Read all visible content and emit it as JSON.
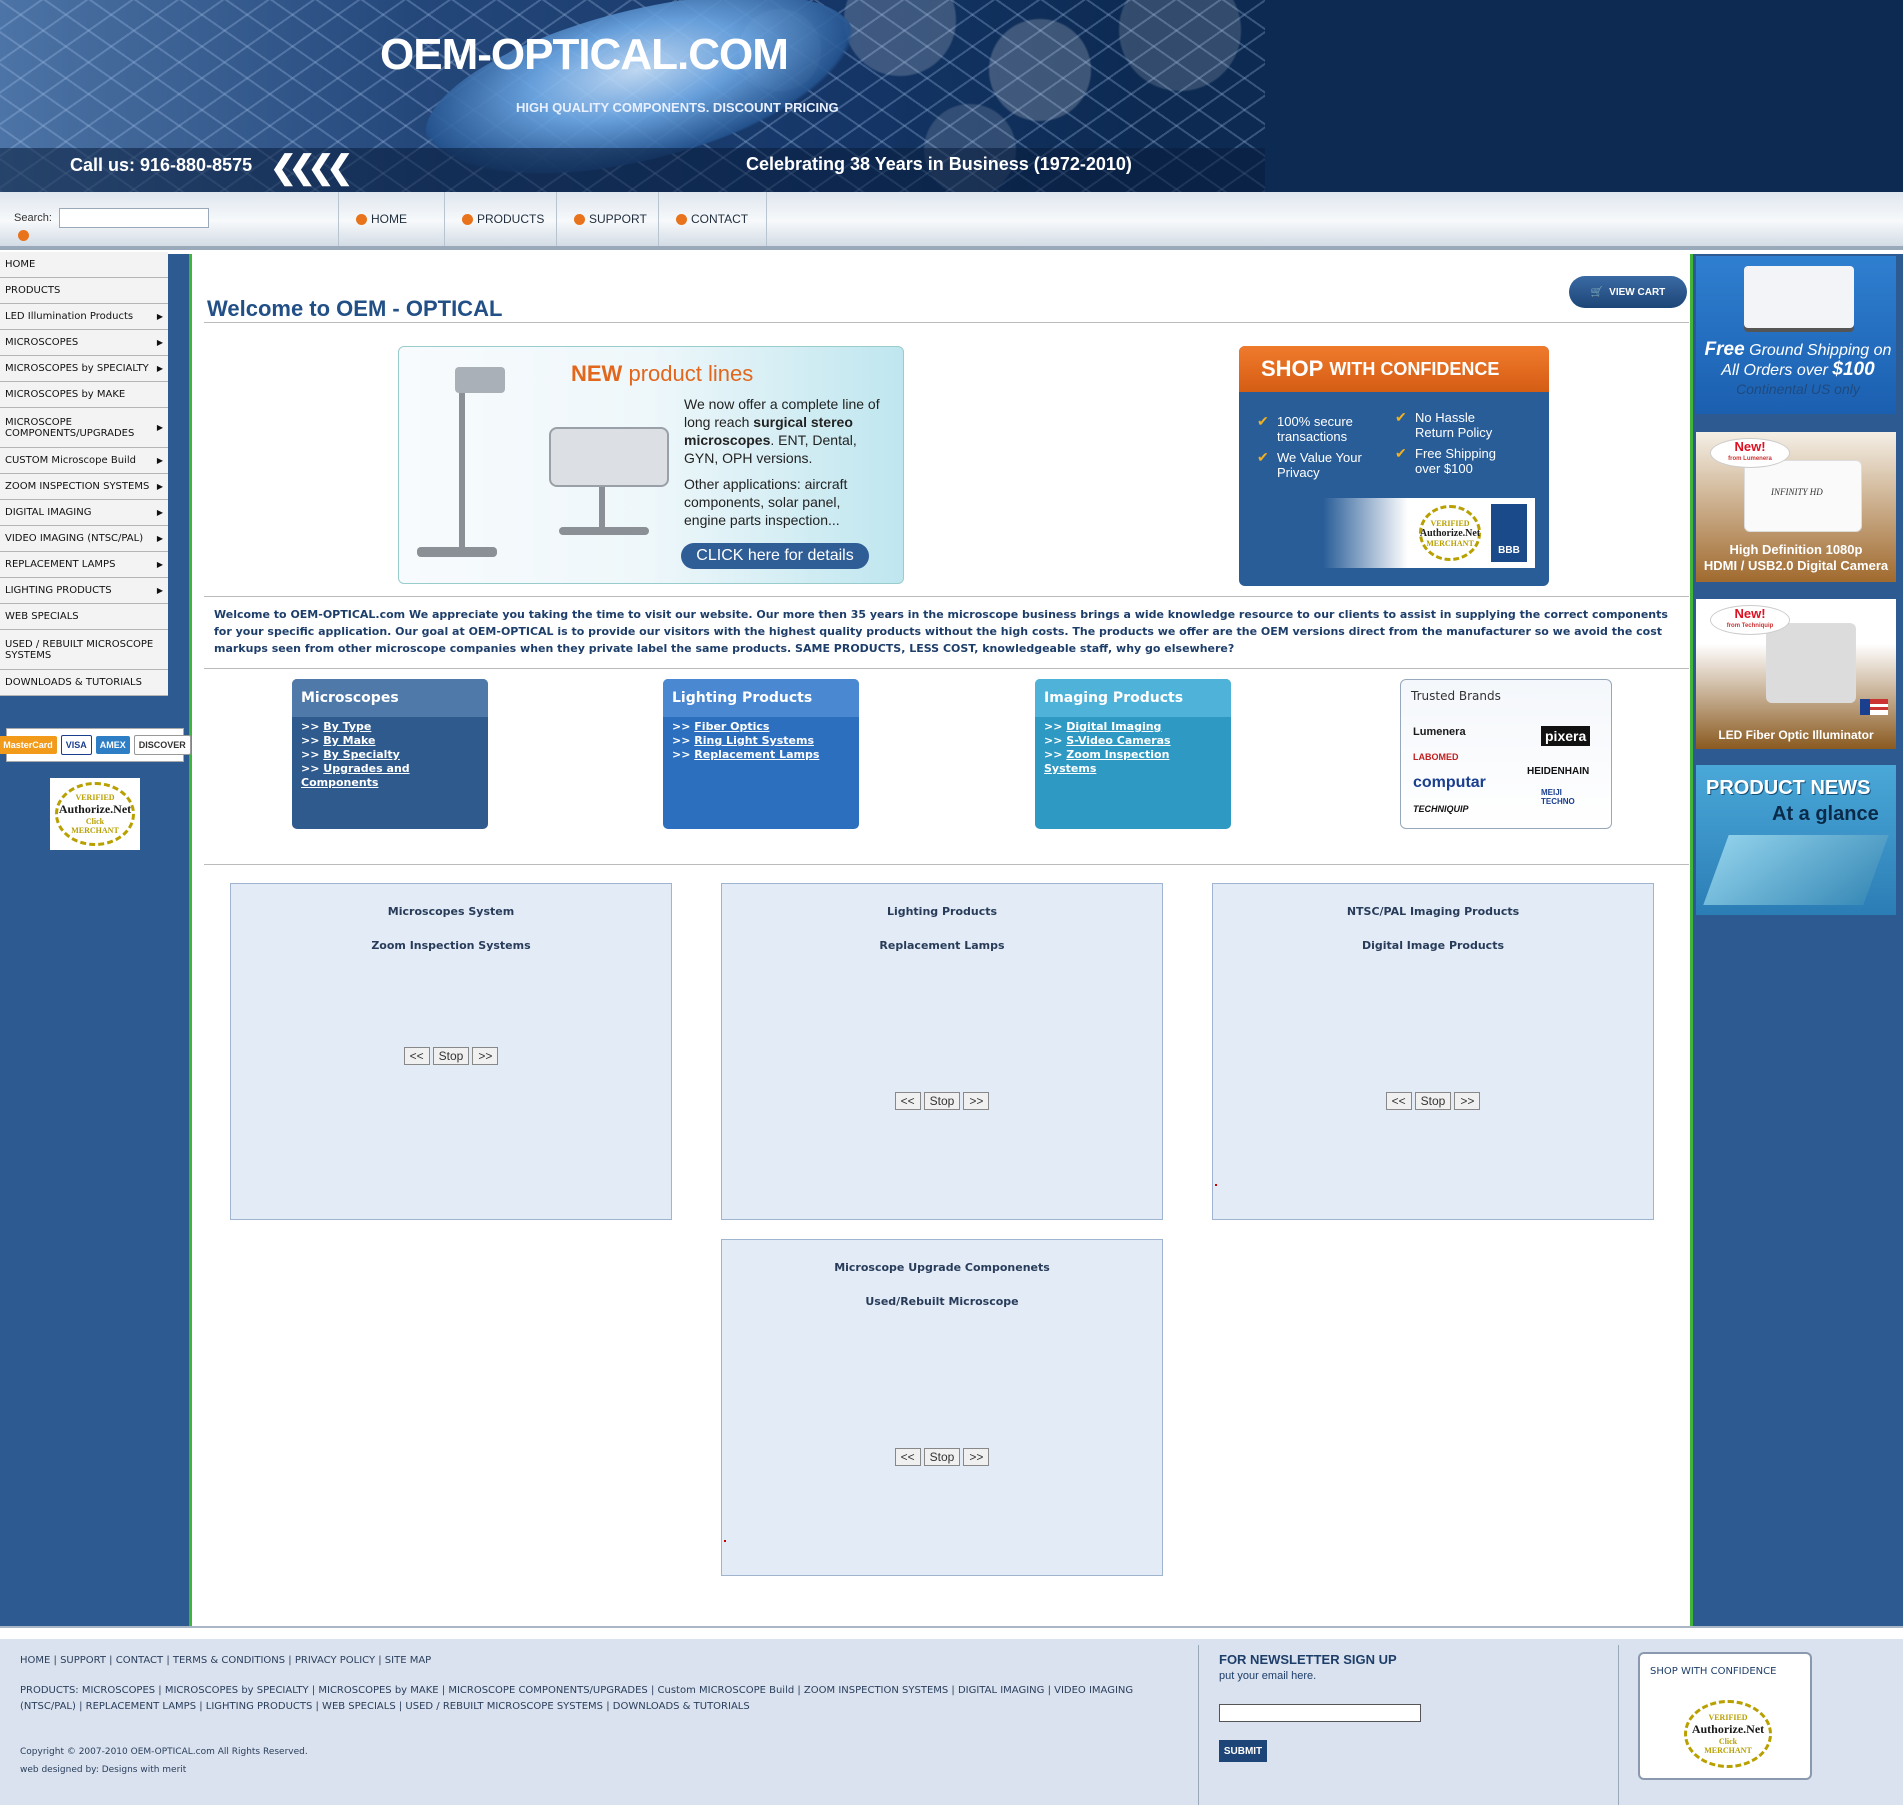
{
  "header": {
    "logo": "OEM-OPTICAL.COM",
    "tagline": "HIGH QUALITY COMPONENTS. DISCOUNT PRICING",
    "phone": "Call us: 916-880-8575",
    "celebrate": "Celebrating 38 Years in Business (1972-2010)"
  },
  "nav": {
    "search_label": "Search:",
    "search_value": "",
    "tabs": [
      "HOME",
      "PRODUCTS",
      "SUPPORT",
      "CONTACT"
    ]
  },
  "leftmenu": [
    {
      "label": "HOME",
      "arrow": false
    },
    {
      "label": "PRODUCTS",
      "arrow": false
    },
    {
      "label": "LED Illumination Products",
      "arrow": true
    },
    {
      "label": "MICROSCOPES",
      "arrow": true
    },
    {
      "label": "MICROSCOPES by SPECIALTY",
      "arrow": true
    },
    {
      "label": "MICROSCOPES by MAKE",
      "arrow": false
    },
    {
      "label": "MICROSCOPE COMPONENTS/UPGRADES",
      "arrow": true
    },
    {
      "label": "CUSTOM Microscope Build",
      "arrow": true
    },
    {
      "label": "ZOOM INSPECTION SYSTEMS",
      "arrow": true
    },
    {
      "label": "DIGITAL IMAGING",
      "arrow": true
    },
    {
      "label": "VIDEO IMAGING (NTSC/PAL)",
      "arrow": true
    },
    {
      "label": "REPLACEMENT LAMPS",
      "arrow": true
    },
    {
      "label": "LIGHTING PRODUCTS",
      "arrow": true
    },
    {
      "label": "WEB SPECIALS",
      "arrow": false
    },
    {
      "label": "USED / REBUILT MICROSCOPE SYSTEMS",
      "arrow": false
    },
    {
      "label": "DOWNLOADS & TUTORIALS",
      "arrow": false
    }
  ],
  "cards": [
    "MasterCard",
    "VISA",
    "AMEX",
    "DISCOVER"
  ],
  "seal": {
    "top": "VERIFIED",
    "name": "Authorize.Net",
    "click": "Click",
    "bottom": "MERCHANT"
  },
  "main": {
    "view_cart": "VIEW CART",
    "title": "Welcome to OEM - OPTICAL",
    "new_box": {
      "heading_bold": "NEW",
      "heading_rest": "product lines",
      "p1a": "We now offer a complete line of long reach ",
      "p1b": "surgical stereo microscopes",
      "p1c": ". ENT, Dental, GYN, OPH versions.",
      "p2": "Other applications: aircraft components, solar panel, engine parts inspection...",
      "cta": "CLICK here for details"
    },
    "shop_box": {
      "head_bold": "SHOP",
      "head_rest": "WITH CONFIDENCE",
      "points": [
        "100% secure transactions",
        "No Hassle Return Policy",
        "We Value Your Privacy",
        "Free Shipping over $100"
      ],
      "bbb": "BBB"
    },
    "intro": "Welcome to OEM-OPTICAL.com We appreciate you taking the time to visit our website. Our more then 35 years in the microscope business brings a wide knowledge resource to our clients to assist in supplying the correct components for your specific application. Our goal at OEM-OPTICAL is to provide our visitors with the highest quality products without the high costs. The products we offer are the OEM versions direct from the manufacturer so we avoid the cost markups seen from other microscope companies when they private label the same products. SAME PRODUCTS, LESS COST, knowledgeable staff, why go elsewhere?",
    "categories": [
      {
        "title": "Microscopes",
        "links": [
          "By Type",
          "By Make",
          "By Specialty",
          "Upgrades and Components"
        ]
      },
      {
        "title": "Lighting Products",
        "links": [
          "Fiber Optics",
          "Ring Light Systems",
          "Replacement Lamps"
        ]
      },
      {
        "title": "Imaging Products",
        "links": [
          "Digital Imaging",
          "S-Video Cameras",
          "Zoom Inspection Systems"
        ]
      }
    ],
    "link_prefix": ">>",
    "brands": {
      "title": "Trusted Brands",
      "names": [
        "Lumenera",
        "pixera",
        "LABOMED",
        "HEIDENHAIN",
        "computar",
        "MEIJI TECHNO",
        "TECHNIQUIP"
      ]
    },
    "panels": [
      {
        "t1": "Microscopes System",
        "t2": "Zoom Inspection Systems"
      },
      {
        "t1": "Lighting Products",
        "t2": "Replacement Lamps"
      },
      {
        "t1": "NTSC/PAL Imaging Products",
        "t2": "Digital Image Products"
      },
      {
        "t1": "Microscope Upgrade Componenets",
        "t2": "Used/Rebuilt Microscope"
      }
    ],
    "controls": [
      "<<",
      "Stop",
      ">>"
    ]
  },
  "right": {
    "p1": {
      "free": "Free",
      "l1": " Ground Shipping on",
      "l2": "All Orders over ",
      "amount": "$100",
      "l3": "Continental US only"
    },
    "p2": {
      "new": "New!",
      "from": "from Lumenera",
      "brand": "INFINITY HD",
      "cap1": "High Definition 1080p",
      "cap2": "HDMI / USB2.0 Digital Camera"
    },
    "p3": {
      "new": "New!",
      "from": "from Techniquip",
      "cap": "LED Fiber Optic Illuminator"
    },
    "p4": {
      "news": "PRODUCT NEWS",
      "glance": "At a glance"
    }
  },
  "footer": {
    "links1": "HOME | SUPPORT | CONTACT | TERMS & CONDITIONS | PRIVACY POLICY | SITE MAP",
    "links2": "PRODUCTS: MICROSCOPES | MICROSCOPES by SPECIALTY | MICROSCOPES by MAKE | MICROSCOPE COMPONENTS/UPGRADES | Custom MICROSCOPE Build | ZOOM INSPECTION SYSTEMS | DIGITAL IMAGING | VIDEO IMAGING (NTSC/PAL) | REPLACEMENT LAMPS | LIGHTING PRODUCTS | WEB SPECIALS | USED / REBUILT MICROSCOPE SYSTEMS | DOWNLOADS & TUTORIALS",
    "copyright": "Copyright © 2007-2010 OEM-OPTICAL.com All Rights Reserved.",
    "designed": "web designed by: Designs with merit",
    "newsletter_title": "FOR NEWSLETTER SIGN UP",
    "newsletter_sub": "put your email here.",
    "newsletter_value": "",
    "submit": "SUBMIT",
    "shop_title": "SHOP WITH CONFIDENCE"
  }
}
